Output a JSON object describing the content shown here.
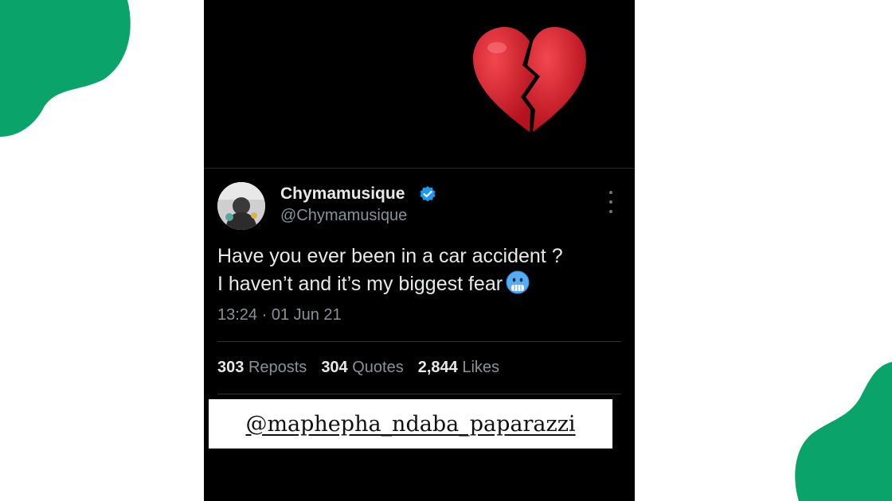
{
  "colors": {
    "blob": "#0aa36a",
    "panel_background": "#000000",
    "verified_blue": "#1d9bf0",
    "heart_red": "#d42333"
  },
  "decor": {
    "heart_icon": "broken-heart-emoji",
    "top_left_blob": "green-blob",
    "bottom_right_blob": "green-blob"
  },
  "post": {
    "author": {
      "display_name": "Chymamusique",
      "handle": "@Chymamusique",
      "verified": true,
      "avatar_icon": "profile-photo"
    },
    "text_lines": [
      "Have you ever been in a car accident ?",
      "I haven’t and it’s my biggest fear"
    ],
    "emoji": "cold-face-emoji",
    "timestamp": "13:24 · 01 Jun 21",
    "stats": [
      {
        "count": "303",
        "label": "Reposts"
      },
      {
        "count": "304",
        "label": "Quotes"
      },
      {
        "count": "2,844",
        "label": "Likes"
      }
    ],
    "more_icon": "more-options-icon"
  },
  "watermark": {
    "text": "@maphepha_ndaba_paparazzi"
  }
}
